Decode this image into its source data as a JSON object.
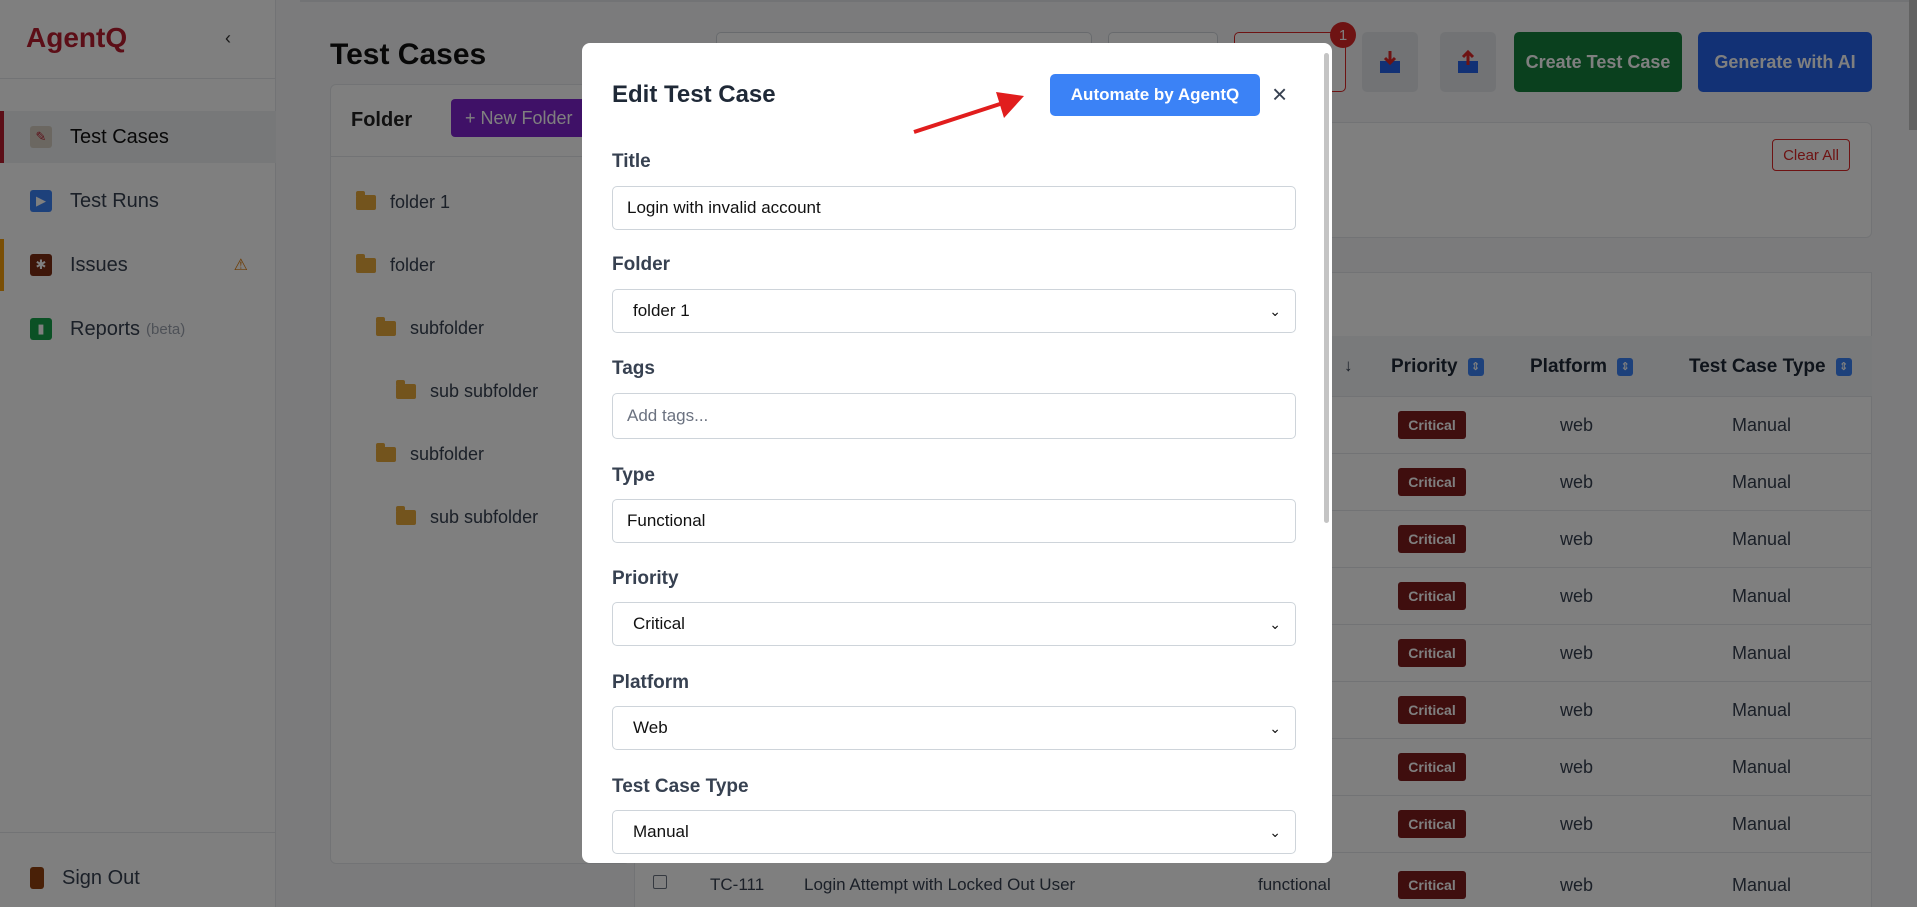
{
  "sidebar": {
    "brand": "AgentQ",
    "collapse": "‹",
    "items": [
      {
        "label": "Test Cases",
        "icon": "test-cases-icon"
      },
      {
        "label": "Test Runs",
        "icon": "play-icon"
      },
      {
        "label": "Issues",
        "icon": "bug-icon"
      },
      {
        "label": "Reports",
        "suffix": "(beta)",
        "icon": "chart-icon"
      }
    ],
    "signout": "Sign Out"
  },
  "page": {
    "title": "Test Cases",
    "folder_title": "Folder",
    "new_folder": "+ New Folder"
  },
  "tree": [
    {
      "label": "folder 1"
    },
    {
      "label": "folder"
    },
    {
      "label": "subfolder"
    },
    {
      "label": "sub subfolder"
    },
    {
      "label": "subfolder"
    },
    {
      "label": "sub subfolder"
    }
  ],
  "toolbar": {
    "badge": "1",
    "create": "Create Test Case",
    "generate": "Generate with AI"
  },
  "filters": {
    "clear_all": "Clear All"
  },
  "table": {
    "headers": {
      "priority": "Priority",
      "platform": "Platform",
      "type": "Test Case Type",
      "sort_arrow": "↓"
    },
    "rows": [
      {
        "priority": "Critical",
        "platform": "web",
        "type": "Manual"
      },
      {
        "priority": "Critical",
        "platform": "web",
        "type": "Manual"
      },
      {
        "priority": "Critical",
        "platform": "web",
        "type": "Manual"
      },
      {
        "priority": "Critical",
        "platform": "web",
        "type": "Manual"
      },
      {
        "priority": "Critical",
        "platform": "web",
        "type": "Manual"
      },
      {
        "priority": "Critical",
        "platform": "web",
        "type": "Manual"
      },
      {
        "priority": "Critical",
        "platform": "web",
        "type": "Manual"
      },
      {
        "priority": "Critical",
        "platform": "web",
        "type": "Manual"
      }
    ],
    "last_row": {
      "id": "TC-111",
      "title": "Login Attempt with Locked Out User",
      "type_col": "functional",
      "priority": "Critical",
      "platform": "web",
      "type": "Manual"
    }
  },
  "modal": {
    "title": "Edit Test Case",
    "automate": "Automate by AgentQ",
    "close": "×",
    "fields": {
      "title_label": "Title",
      "title_value": "Login with invalid account",
      "folder_label": "Folder",
      "folder_value": "folder 1",
      "tags_label": "Tags",
      "tags_placeholder": "Add tags...",
      "type_label": "Type",
      "type_value": "Functional",
      "priority_label": "Priority",
      "priority_value": "Critical",
      "platform_label": "Platform",
      "platform_value": "Web",
      "tctype_label": "Test Case Type",
      "tctype_value": "Manual"
    }
  },
  "colors": {
    "brand": "#b91c2e",
    "create": "#15803d",
    "generate": "#2563eb",
    "automate": "#3b82f6",
    "critical": "#7f1d1d",
    "arrow": "#e11d1d"
  }
}
